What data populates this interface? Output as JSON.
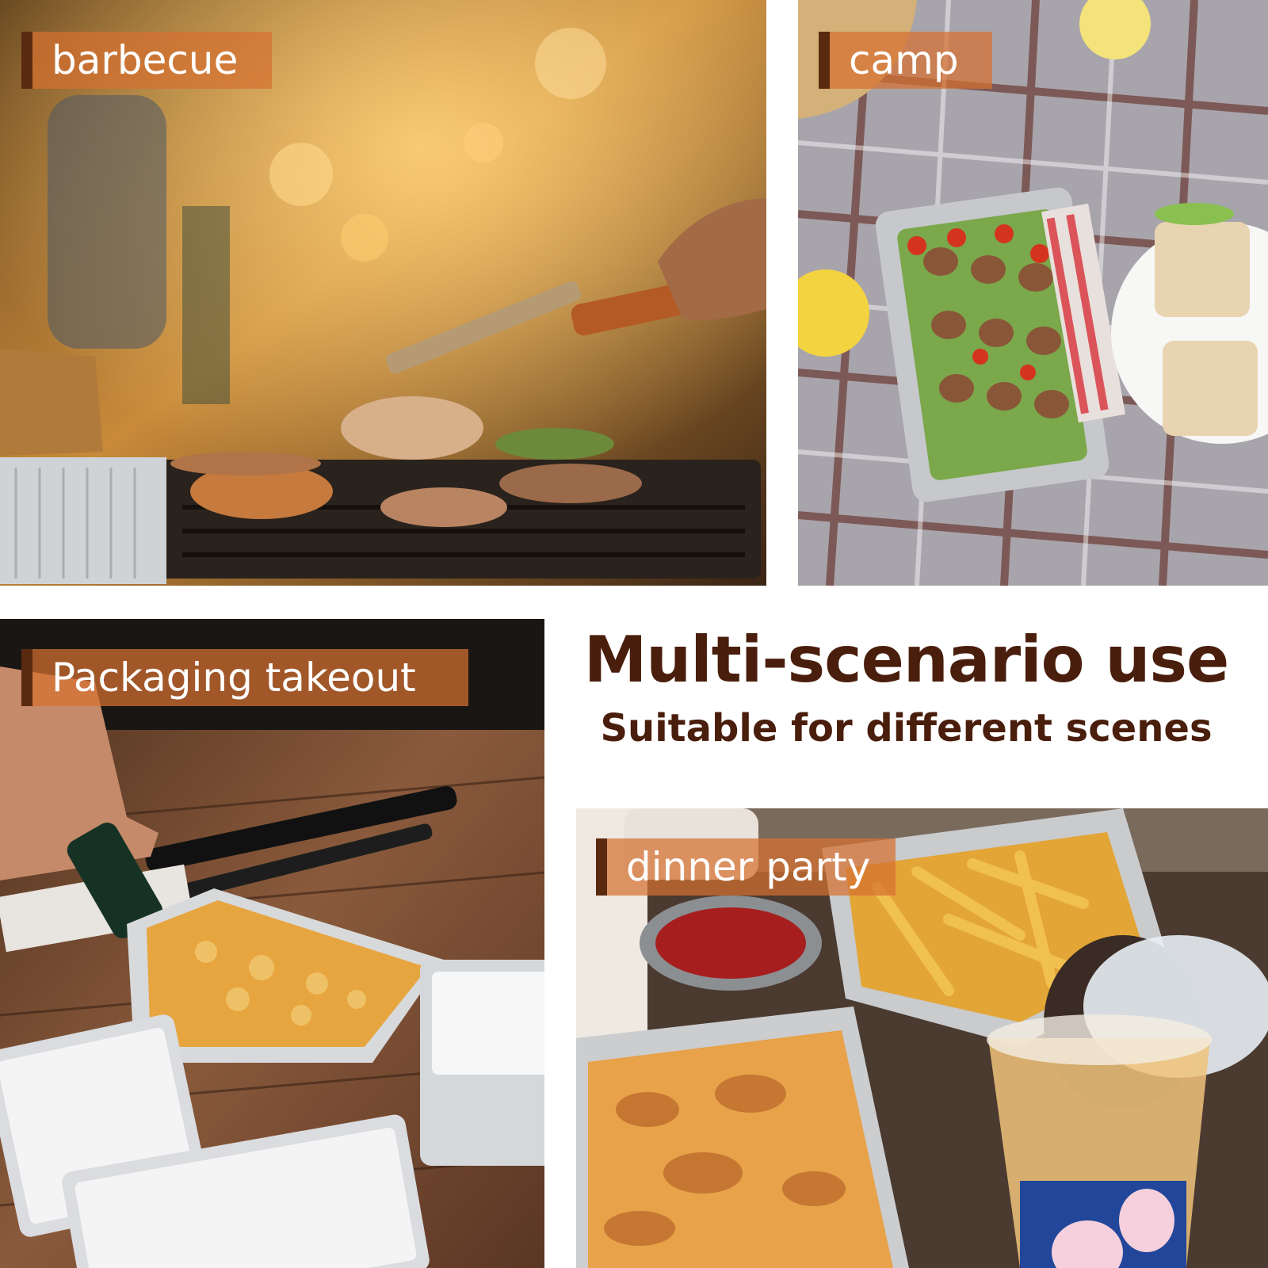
{
  "tiles": {
    "barbecue": {
      "label": "barbecue"
    },
    "camp": {
      "label": "camp"
    },
    "packaging_takeout": {
      "label": "Packaging takeout"
    },
    "dinner_party": {
      "label": "dinner party"
    }
  },
  "headline": {
    "title": "Multi-scenario use",
    "subtitle": "Suitable for different scenes"
  },
  "colors": {
    "tag_background": "#d67030",
    "tag_accent_bar": "#5a2a10",
    "headline_text": "#4a1e0c",
    "page_background": "#ffffff"
  }
}
